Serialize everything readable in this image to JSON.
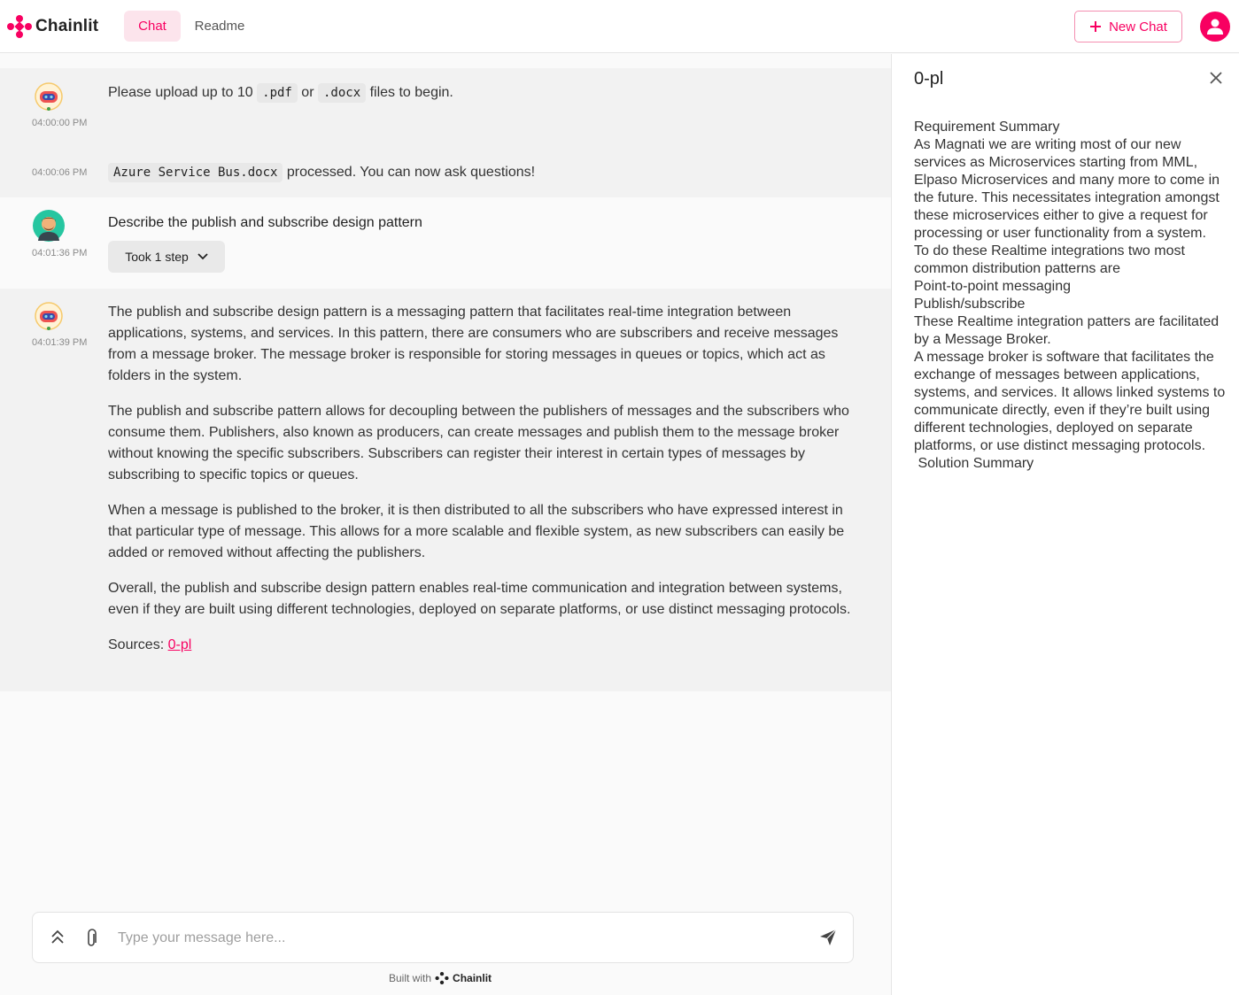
{
  "header": {
    "logo_text": "Chainlit",
    "nav": {
      "chat": "Chat",
      "readme": "Readme"
    },
    "new_chat_label": "New Chat"
  },
  "messages": {
    "m1": {
      "pre": "Please upload up to 10 ",
      "code1": ".pdf",
      "mid": " or ",
      "code2": ".docx",
      "post": " files to begin.",
      "time": "04:00:00 PM"
    },
    "m2": {
      "code": "Azure Service Bus.docx",
      "post": " processed. You can now ask questions!",
      "time": "04:00:06 PM"
    },
    "m3": {
      "text": "Describe the publish and subscribe design pattern",
      "time": "04:01:36 PM",
      "step_label": "Took 1 step"
    },
    "m4": {
      "time": "04:01:39 PM",
      "paragraphs": [
        "The publish and subscribe design pattern is a messaging pattern that facilitates real-time integration between applications, systems, and services. In this pattern, there are consumers who are subscribers and receive messages from a message broker. The message broker is responsible for storing messages in queues or topics, which act as folders in the system.",
        "The publish and subscribe pattern allows for decoupling between the publishers of messages and the subscribers who consume them. Publishers, also known as producers, can create messages and publish them to the message broker without knowing the specific subscribers. Subscribers can register their interest in certain types of messages by subscribing to specific topics or queues.",
        "When a message is published to the broker, it is then distributed to all the subscribers who have expressed interest in that particular type of message. This allows for a more scalable and flexible system, as new subscribers can easily be added or removed without affecting the publishers.",
        "Overall, the publish and subscribe design pattern enables real-time communication and integration between systems, even if they are built using different technologies, deployed on separate platforms, or use distinct messaging protocols."
      ],
      "sources_label": "Sources: ",
      "source_link": "0-pl"
    }
  },
  "input": {
    "placeholder": "Type your message here..."
  },
  "footer": {
    "built_with": "Built with",
    "brand": "Chainlit"
  },
  "panel": {
    "title": "0-pl",
    "lines": [
      "Requirement Summary",
      "As Magnati we are writing most of our new services as Microservices starting from MML, Elpaso Microservices and many more to come in the future. This necessitates integration amongst these microservices either to give a request for processing or user functionality from a system.",
      "To do these Realtime integrations two most common distribution patterns are",
      "Point-to-point messaging",
      "Publish/subscribe",
      "These Realtime integration patters are facilitated by a Message Broker.",
      "A message broker is software that facilitates the exchange of messages between applications, systems, and services. It allows linked systems to communicate directly, even if they’re built using different technologies, deployed on separate platforms, or use distinct messaging protocols.",
      " Solution Summary"
    ]
  },
  "colors": {
    "accent": "#f80061",
    "accent_light": "#fce4ec"
  }
}
